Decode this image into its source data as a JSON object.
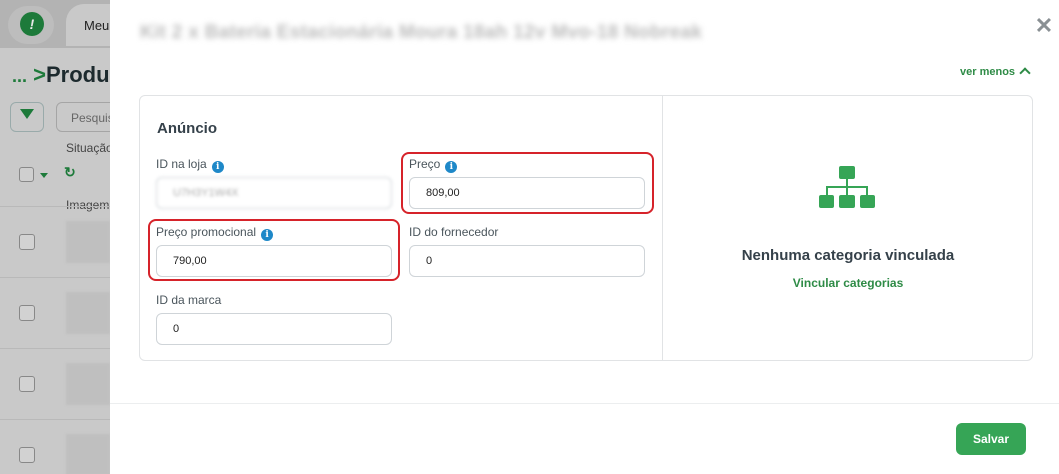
{
  "background": {
    "logo_letter": "!",
    "tab_label": "Meu",
    "breadcrumb": {
      "ellipsis": "...",
      "current": "Produ"
    },
    "search_placeholder": "Pesquis",
    "status_label": "Situação",
    "image_column_header": "Imagem",
    "rows": 4
  },
  "modal": {
    "title": "Kit 2 x Bateria Estacionária Moura 18ah 12v Mvo-18 Nobreak",
    "close_label": "✕",
    "toggle_label": "ver menos",
    "section_title": "Anúncio",
    "fields": {
      "id_loja": {
        "label": "ID na loja",
        "value": "U7H3Y1W4X"
      },
      "preco": {
        "label": "Preço",
        "value": "809,00"
      },
      "preco_promocional": {
        "label": "Preço promocional",
        "value": "790,00"
      },
      "id_fornecedor": {
        "label": "ID do fornecedor",
        "value": "0"
      },
      "id_marca": {
        "label": "ID da marca",
        "value": "0"
      }
    },
    "category": {
      "empty_title": "Nenhuma categoria vinculada",
      "link_label": "Vincular categorias"
    },
    "save_label": "Salvar"
  },
  "colors": {
    "brand_green": "#36a556",
    "link_green": "#2e8b46",
    "highlight_red": "#d6232a",
    "info_blue": "#1e88c8"
  },
  "icons": [
    "filter-icon",
    "refresh-icon",
    "close-icon",
    "chevron-up-icon",
    "info-icon",
    "sitemap-icon"
  ]
}
